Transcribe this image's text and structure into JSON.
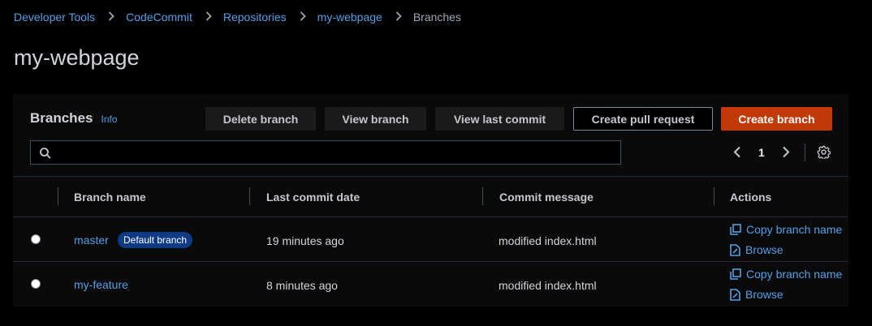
{
  "breadcrumb": [
    "Developer Tools",
    "CodeCommit",
    "Repositories",
    "my-webpage",
    "Branches"
  ],
  "page": {
    "title": "my-webpage"
  },
  "panel": {
    "title": "Branches",
    "info": "Info",
    "buttons": {
      "delete": "Delete branch",
      "view": "View branch",
      "view_last_commit": "View last commit",
      "create_pr": "Create pull request",
      "create": "Create branch"
    },
    "search": {
      "placeholder": "",
      "value": ""
    },
    "pagination": {
      "current_page": "1"
    }
  },
  "table": {
    "headers": [
      "Branch name",
      "Last commit date",
      "Commit message",
      "Actions"
    ],
    "rows": [
      {
        "branch": "master",
        "badge": "Default branch",
        "date": "19 minutes ago",
        "message": "modified index.html",
        "copy": "Copy branch name",
        "browse": "Browse"
      },
      {
        "branch": "my-feature",
        "badge": "",
        "date": "8 minutes ago",
        "message": "modified index.html",
        "copy": "Copy branch name",
        "browse": "Browse"
      }
    ]
  },
  "colors": {
    "link": "#539fe5",
    "primary": "#c13a07",
    "badge": "#0f3a85"
  },
  "icons": [
    "chevron-right-icon",
    "search-icon",
    "chevron-left-icon",
    "gear-icon",
    "copy-icon",
    "file-icon"
  ]
}
